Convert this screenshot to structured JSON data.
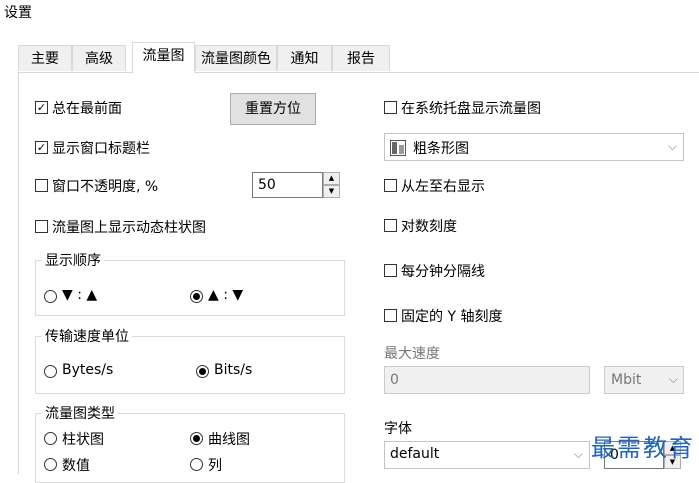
{
  "window": {
    "title": "设置"
  },
  "tabs": [
    {
      "label": "主要"
    },
    {
      "label": "高级"
    },
    {
      "label": "流量图"
    },
    {
      "label": "流量图颜色"
    },
    {
      "label": "通知"
    },
    {
      "label": "报告"
    }
  ],
  "active_tab": "流量图",
  "left": {
    "always_on_top": {
      "label": "总在最前面",
      "checked": true
    },
    "reset_position_button": "重置方位",
    "show_title_bar": {
      "label": "显示窗口标题栏",
      "checked": true
    },
    "opacity": {
      "label": "窗口不透明度, %",
      "checked": false,
      "value": "50"
    },
    "dynamic_bars": {
      "label": "流量图上显示动态柱状图",
      "checked": false
    },
    "display_order": {
      "title": "显示顺序",
      "options": [
        {
          "label": "▼ : ▲",
          "selected": false
        },
        {
          "label": "▲ : ▼",
          "selected": true
        }
      ]
    },
    "speed_unit": {
      "title": "传输速度单位",
      "options": [
        {
          "label": "Bytes/s",
          "selected": false
        },
        {
          "label": "Bits/s",
          "selected": true
        }
      ]
    },
    "graph_type": {
      "title": "流量图类型",
      "options": [
        {
          "label": "柱状图",
          "selected": false
        },
        {
          "label": "曲线图",
          "selected": true
        },
        {
          "label": "数值",
          "selected": false
        },
        {
          "label": "列",
          "selected": false
        }
      ]
    }
  },
  "right": {
    "show_in_tray": {
      "label": "在系统托盘显示流量图",
      "checked": false
    },
    "bar_style": {
      "value": "粗条形图"
    },
    "left_to_right": {
      "label": "从左至右显示",
      "checked": false
    },
    "log_scale": {
      "label": "对数刻度",
      "checked": false
    },
    "minute_lines": {
      "label": "每分钟分隔线",
      "checked": false
    },
    "fixed_y_scale": {
      "label": "固定的 Y 轴刻度",
      "checked": false
    },
    "max_speed": {
      "label": "最大速度",
      "value": "0",
      "unit": "Mbit"
    },
    "font": {
      "label": "字体",
      "value": "default",
      "size": "0"
    }
  },
  "watermark": "最需教育",
  "colors": {
    "accent_watermark": "#1f63c6",
    "tab_bg": "#f0f0f0",
    "button_bg": "#e1e1e1"
  }
}
